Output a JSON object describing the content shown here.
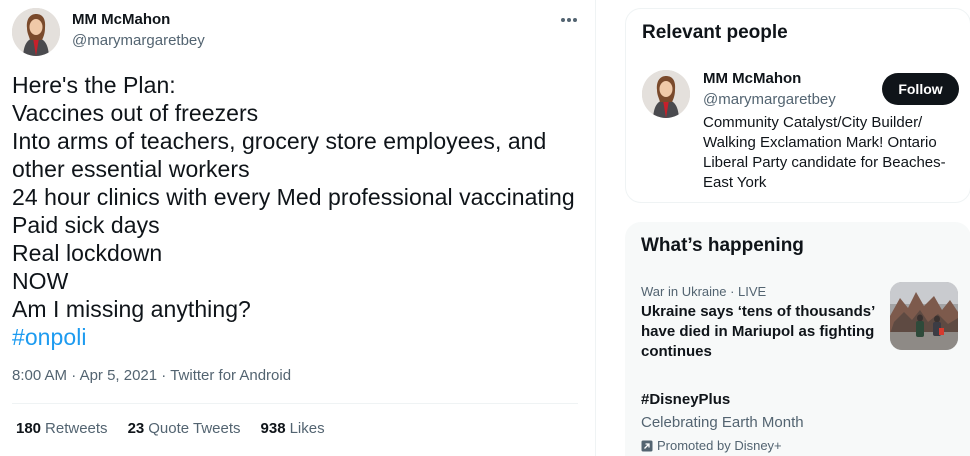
{
  "tweet": {
    "author": {
      "name": "MM McMahon",
      "handle": "@marymargaretbey"
    },
    "lines": [
      "Here's the Plan:",
      "Vaccines out of freezers",
      "Into arms of teachers, grocery store employees, and",
      "other essential workers",
      "24 hour clinics with every Med professional vaccinating",
      "Paid sick days",
      "Real lockdown",
      "NOW",
      "Am I missing anything?"
    ],
    "hashtag": "#onpoli",
    "time": "8:00 AM",
    "date": "Apr 5, 2021",
    "source": "Twitter for Android",
    "separator": " · ",
    "stats": {
      "retweets_count": "180",
      "retweets_label": "Retweets",
      "quotes_count": "23",
      "quotes_label": "Quote Tweets",
      "likes_count": "938",
      "likes_label": "Likes"
    }
  },
  "sidebar": {
    "relevant_people": {
      "title": "Relevant people",
      "person": {
        "name": "MM McMahon",
        "handle": "@marymargaretbey",
        "follow_label": "Follow",
        "bio_lines": [
          "Community Catalyst/City Builder/",
          "Walking Exclamation Mark! Ontario",
          "Liberal Party candidate for Beaches-",
          "East York"
        ]
      }
    },
    "whats_happening": {
      "title": "What’s happening",
      "trend1": {
        "meta": "War in Ukraine · LIVE",
        "headline_lines": [
          "Ukraine says ‘tens of thousands’",
          "have died in Mariupol as fighting",
          "continues"
        ]
      },
      "trend2": {
        "name": "#DisneyPlus",
        "subtitle": "Celebrating Earth Month",
        "promoted": "Promoted by Disney+"
      }
    }
  },
  "colors": {
    "accent": "#1d9bf0",
    "text_primary": "#0f1419",
    "text_secondary": "#536471",
    "border": "#eff3f4",
    "panel_bg": "#f7f9f9"
  }
}
